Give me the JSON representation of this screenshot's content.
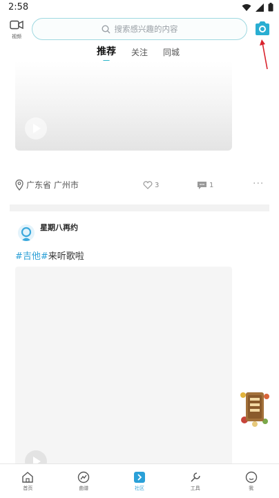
{
  "status_bar": {
    "time": "2:58"
  },
  "header": {
    "video_label": "视频",
    "search_placeholder": "搜索感兴趣的内容"
  },
  "tabs": [
    {
      "label": "推荐",
      "active": true
    },
    {
      "label": "关注",
      "active": false
    },
    {
      "label": "同城",
      "active": false
    }
  ],
  "post1": {
    "location": "广东省 广州市",
    "likes": "3",
    "comments": "1"
  },
  "post2": {
    "username": "星期八再约",
    "hashtag": "#吉他#",
    "text": "来听歌啦"
  },
  "bottom_nav": [
    {
      "label": "首页",
      "icon": "home-icon"
    },
    {
      "label": "曲谱",
      "icon": "score-icon"
    },
    {
      "label": "社区",
      "icon": "community-icon",
      "active": true
    },
    {
      "label": "工具",
      "icon": "tools-icon"
    },
    {
      "label": "我",
      "icon": "profile-icon"
    }
  ],
  "colors": {
    "accent": "#28b4c8",
    "hashtag": "#2a9fd6",
    "arrow": "#d9232d"
  }
}
